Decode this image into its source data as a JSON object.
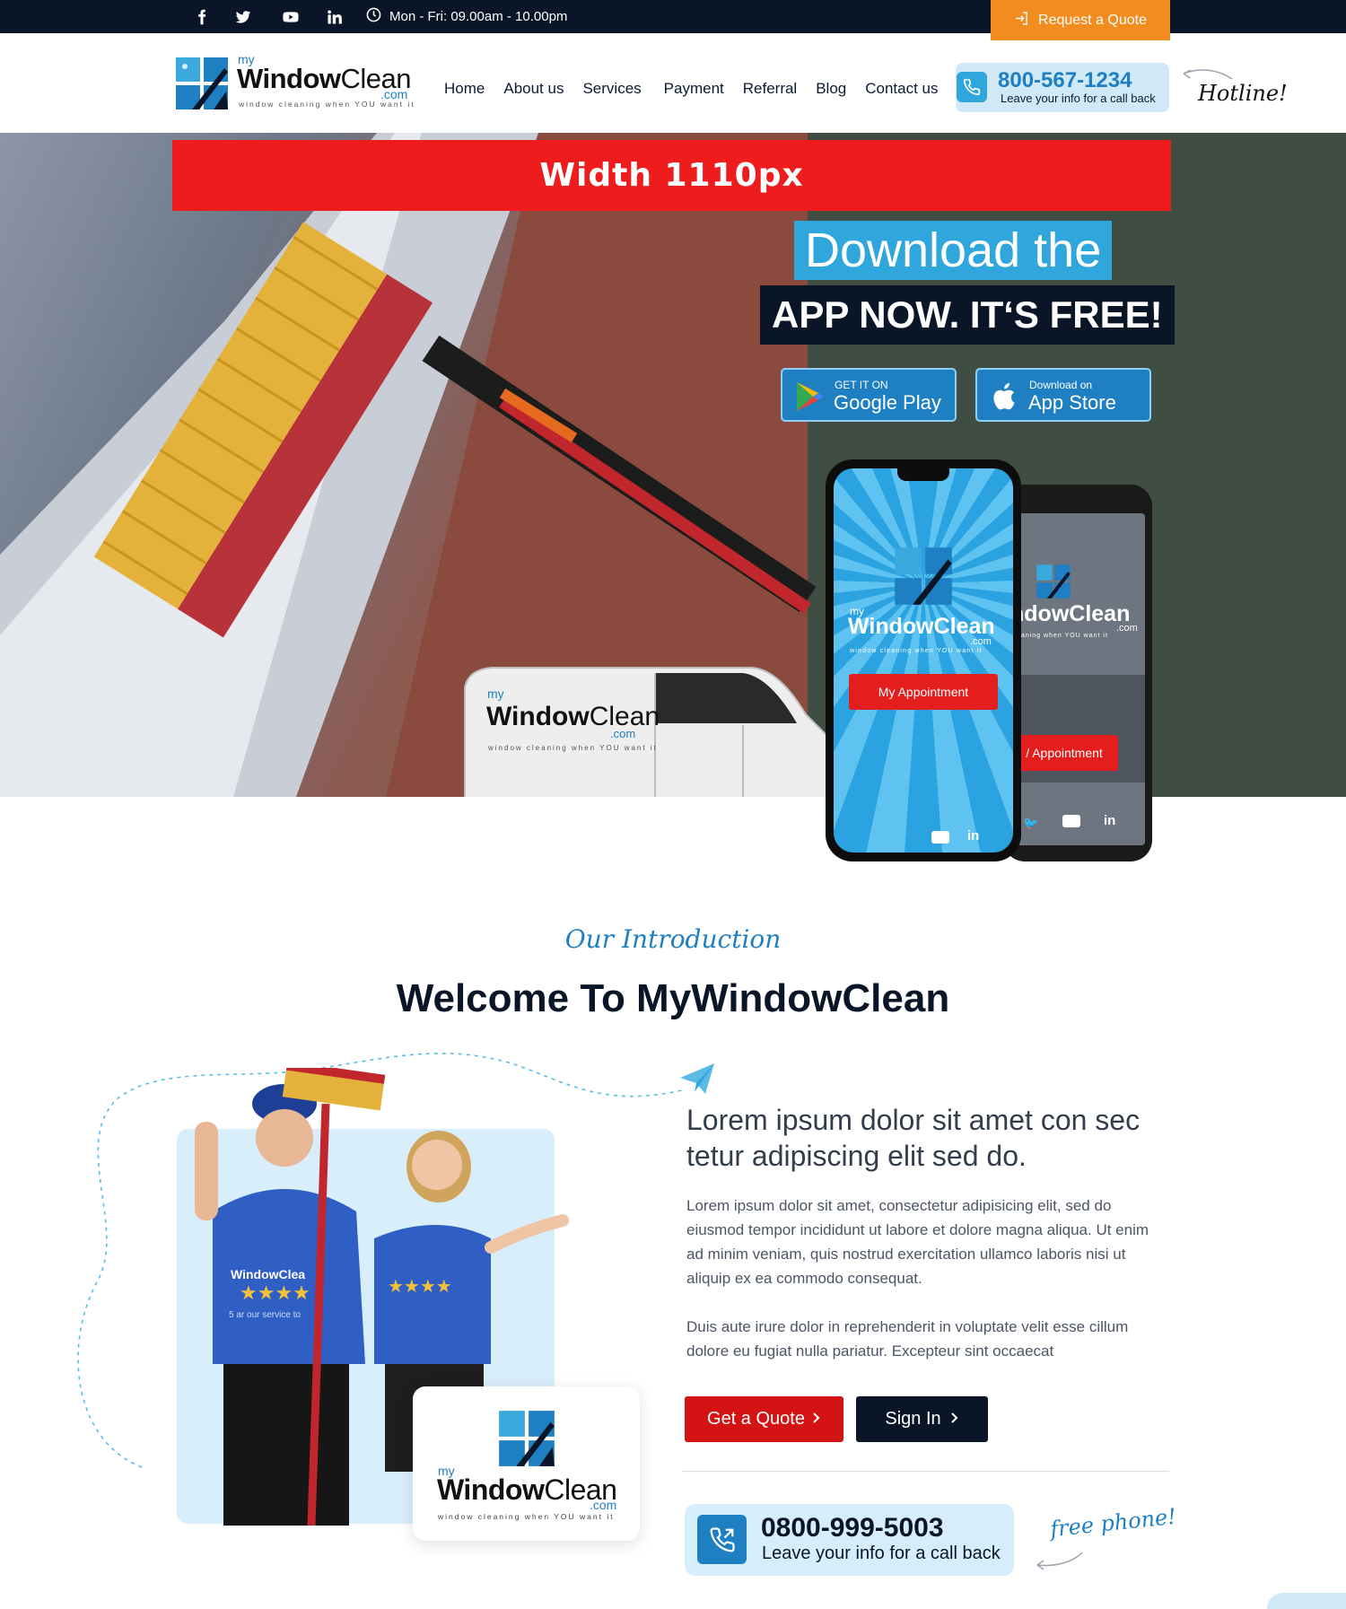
{
  "topbar": {
    "social": [
      {
        "name": "facebook-icon"
      },
      {
        "name": "twitter-icon"
      },
      {
        "name": "youtube-icon"
      },
      {
        "name": "linkedin-icon"
      }
    ],
    "hours": "Mon - Fri: 09.00am - 10.00pm",
    "quote_button": "Request a Quote"
  },
  "logo": {
    "my": "my",
    "window": "Window",
    "clean": "Clean",
    "com": ".com",
    "tagline": "window cleaning when YOU want it"
  },
  "nav": {
    "items": [
      "Home",
      "About us",
      "Services",
      "Payment",
      "Referral",
      "Blog",
      "Contact us"
    ]
  },
  "hotline": {
    "number": "800-567-1234",
    "sub": "Leave your info for a call back",
    "script": "Hotline!"
  },
  "hero": {
    "width_banner": "Width 1110px",
    "line1": "Download the",
    "line2": "APP NOW. IT‘S FREE!",
    "google_small": "GET IT ON",
    "google_big": "Google Play",
    "apple_small": "Download on",
    "apple_big": "App Store",
    "phone_front_brand": "WindowClean",
    "phone_front_my": "my",
    "phone_front_com": ".com",
    "phone_front_tag": "window cleaning when YOU want it",
    "phone_front_button": "My Appointment",
    "phone_back_brand": "ndowClean",
    "phone_back_com": ".com",
    "phone_back_tag": "cleaning when YOU want it",
    "phone_back_button": "/ Appointment",
    "van_my": "my",
    "van_brand_bold": "Window",
    "van_brand_light": "Clean",
    "van_com": ".com",
    "van_tag": "window cleaning when YOU want it"
  },
  "intro": {
    "script": "Our Introduction",
    "title": "Welcome To MyWindowClean",
    "lead": "Lorem ipsum dolor sit amet con sec tetur adipiscing elit sed do.",
    "para1": "Lorem ipsum dolor sit amet, consectetur adipisicing elit, sed do eiusmod tempor incididunt ut labore et dolore magna aliqua. Ut enim ad minim veniam, quis nostrud exercitation ullamco laboris nisi ut aliquip ex ea commodo consequat.",
    "para2": "Duis aute irure dolor in reprehenderit in voluptate velit esse cillum dolore eu fugiat nulla pariatur. Excepteur sint occaecat",
    "get_quote": "Get a Quote",
    "sign_in": "Sign In",
    "shirt_text": "5 ar our service to",
    "shirt_brand": "WindowClea"
  },
  "free_phone": {
    "number": "0800-999-5003",
    "sub": "Leave your info for a call back",
    "script": "free phone!"
  },
  "colors": {
    "navy": "#0a1628",
    "brand_blue": "#1e7fc2",
    "sky_blue": "#2fa6dc",
    "orange": "#f28c1e",
    "red": "#d41414",
    "banner_red": "#ee1c1c"
  }
}
